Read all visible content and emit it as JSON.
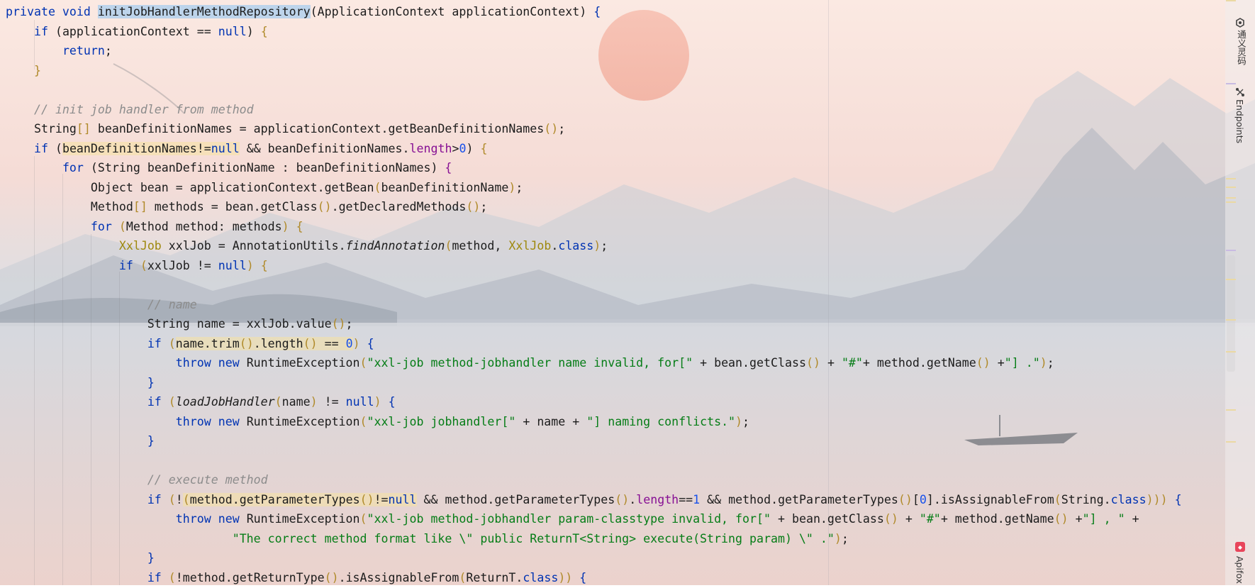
{
  "editor": {
    "lines": [
      [
        [
          "kw",
          "private void "
        ],
        [
          "hl-sel",
          "initJobHandlerMethodRepository"
        ],
        [
          "",
          "("
        ],
        [
          "",
          "ApplicationContext applicationContext"
        ],
        [
          "",
          ") "
        ],
        [
          "kw",
          "{"
        ]
      ],
      [
        [
          "",
          "    "
        ],
        [
          "kw",
          "if "
        ],
        [
          "",
          "(applicationContext == "
        ],
        [
          "kw",
          "null"
        ],
        [
          "",
          ") "
        ],
        [
          "pb",
          "{"
        ]
      ],
      [
        [
          "",
          "        "
        ],
        [
          "kw",
          "return"
        ],
        [
          "",
          ";"
        ]
      ],
      [
        [
          "",
          "    "
        ],
        [
          "pb",
          "}"
        ]
      ],
      [],
      [
        [
          "",
          "    "
        ],
        [
          "cm",
          "// init job handler from method"
        ]
      ],
      [
        [
          "",
          "    String"
        ],
        [
          "pb",
          "[]"
        ],
        [
          "",
          " beanDefinitionNames = applicationContext.getBeanDefinitionNames"
        ],
        [
          "pb",
          "()"
        ],
        [
          "",
          ";"
        ]
      ],
      [
        [
          "",
          "    "
        ],
        [
          "kw",
          "if "
        ],
        [
          "",
          "("
        ],
        [
          "hl-y",
          "beanDefinitionNames!="
        ],
        [
          "hl-y kw",
          "null"
        ],
        [
          "",
          " && beanDefinitionNames."
        ],
        [
          "fld",
          "length"
        ],
        [
          "",
          ">"
        ],
        [
          "num",
          "0"
        ],
        [
          "",
          ") "
        ],
        [
          "pb",
          "{"
        ]
      ],
      [
        [
          "",
          "        "
        ],
        [
          "kw",
          "for "
        ],
        [
          "",
          "(String beanDefinitionName : beanDefinitionNames) "
        ],
        [
          "fld",
          "{"
        ]
      ],
      [
        [
          "",
          "            Object bean = applicationContext.getBean"
        ],
        [
          "pb",
          "("
        ],
        [
          "",
          "beanDefinitionName"
        ],
        [
          "pb",
          ")"
        ],
        [
          "",
          ";"
        ]
      ],
      [
        [
          "",
          "            Method"
        ],
        [
          "pb",
          "[]"
        ],
        [
          "",
          " methods = bean.getClass"
        ],
        [
          "pb",
          "()"
        ],
        [
          "",
          ".getDeclaredMethods"
        ],
        [
          "pb",
          "()"
        ],
        [
          "",
          ";"
        ]
      ],
      [
        [
          "",
          "            "
        ],
        [
          "kw",
          "for "
        ],
        [
          "pb",
          "("
        ],
        [
          "",
          "Method method: methods"
        ],
        [
          "pb",
          ") {"
        ]
      ],
      [
        [
          "",
          "                "
        ],
        [
          "ty",
          "XxlJob"
        ],
        [
          "",
          " xxlJob = AnnotationUtils."
        ],
        [
          "it",
          "findAnnotation"
        ],
        [
          "pb",
          "("
        ],
        [
          "",
          "method, "
        ],
        [
          "ty",
          "XxlJob"
        ],
        [
          "",
          "."
        ],
        [
          "kw",
          "class"
        ],
        [
          "pb",
          ")"
        ],
        [
          "",
          ";"
        ]
      ],
      [
        [
          "",
          "                "
        ],
        [
          "kw",
          "if "
        ],
        [
          "pb",
          "("
        ],
        [
          "",
          "xxlJob != "
        ],
        [
          "kw",
          "null"
        ],
        [
          "pb",
          ") {"
        ]
      ],
      [],
      [
        [
          "",
          "                    "
        ],
        [
          "cm",
          "// name"
        ]
      ],
      [
        [
          "",
          "                    String name = xxlJob.value"
        ],
        [
          "pb",
          "()"
        ],
        [
          "",
          ";"
        ]
      ],
      [
        [
          "",
          "                    "
        ],
        [
          "kw",
          "if "
        ],
        [
          "pb",
          "("
        ],
        [
          "hl-y",
          "name.trim"
        ],
        [
          "hl-y pb",
          "()"
        ],
        [
          "hl-y",
          ".length"
        ],
        [
          "hl-y pb",
          "()"
        ],
        [
          "hl-y",
          " == "
        ],
        [
          "hl-y num",
          "0"
        ],
        [
          "pb",
          ")"
        ],
        [
          "kw",
          " {"
        ]
      ],
      [
        [
          "",
          "                        "
        ],
        [
          "kw",
          "throw new "
        ],
        [
          "",
          "RuntimeException"
        ],
        [
          "pb",
          "("
        ],
        [
          "str",
          "\"xxl-job method-jobhandler name invalid, for[\""
        ],
        [
          "",
          " + bean.getClass"
        ],
        [
          "pb",
          "()"
        ],
        [
          "",
          " + "
        ],
        [
          "str",
          "\"#\""
        ],
        [
          "",
          "+ method.getName"
        ],
        [
          "pb",
          "()"
        ],
        [
          "",
          " +"
        ],
        [
          "str",
          "\"] .\""
        ],
        [
          "pb",
          ")"
        ],
        [
          "",
          ";"
        ]
      ],
      [
        [
          "",
          "                    "
        ],
        [
          "kw",
          "}"
        ]
      ],
      [
        [
          "",
          "                    "
        ],
        [
          "kw",
          "if "
        ],
        [
          "pb",
          "("
        ],
        [
          "it",
          "loadJobHandler"
        ],
        [
          "pb",
          "("
        ],
        [
          "",
          "name"
        ],
        [
          "pb",
          ")"
        ],
        [
          "",
          " != "
        ],
        [
          "kw",
          "null"
        ],
        [
          "pb",
          ")"
        ],
        [
          "kw",
          " {"
        ]
      ],
      [
        [
          "",
          "                        "
        ],
        [
          "kw",
          "throw new "
        ],
        [
          "",
          "RuntimeException"
        ],
        [
          "pb",
          "("
        ],
        [
          "str",
          "\"xxl-job jobhandler[\""
        ],
        [
          "",
          " + name + "
        ],
        [
          "str",
          "\"] naming conflicts.\""
        ],
        [
          "pb",
          ")"
        ],
        [
          "",
          ";"
        ]
      ],
      [
        [
          "",
          "                    "
        ],
        [
          "kw",
          "}"
        ]
      ],
      [],
      [
        [
          "",
          "                    "
        ],
        [
          "cm",
          "// execute method"
        ]
      ],
      [
        [
          "",
          "                    "
        ],
        [
          "kw",
          "if "
        ],
        [
          "pb",
          "("
        ],
        [
          "",
          "!"
        ],
        [
          "hl-y pb",
          "("
        ],
        [
          "hl-y",
          "method.getParameterTypes"
        ],
        [
          "hl-y pb",
          "()"
        ],
        [
          "hl-y",
          "!="
        ],
        [
          "hl-y kw",
          "null"
        ],
        [
          "",
          " && method.getParameterTypes"
        ],
        [
          "pb",
          "()"
        ],
        [
          "",
          "."
        ],
        [
          "fld",
          "length"
        ],
        [
          "",
          "=="
        ],
        [
          "num",
          "1"
        ],
        [
          "",
          " && method.getParameterTypes"
        ],
        [
          "pb",
          "()"
        ],
        [
          "",
          "["
        ],
        [
          "num",
          "0"
        ],
        [
          "",
          "].isAssignableFrom"
        ],
        [
          "pb",
          "("
        ],
        [
          "",
          "String."
        ],
        [
          "kw",
          "class"
        ],
        [
          "pb",
          "))) "
        ],
        [
          "kw",
          "{"
        ]
      ],
      [
        [
          "",
          "                        "
        ],
        [
          "kw",
          "throw new "
        ],
        [
          "",
          "RuntimeException"
        ],
        [
          "pb",
          "("
        ],
        [
          "str",
          "\"xxl-job method-jobhandler param-classtype invalid, for[\""
        ],
        [
          "",
          " + bean.getClass"
        ],
        [
          "pb",
          "()"
        ],
        [
          "",
          " + "
        ],
        [
          "str",
          "\"#\""
        ],
        [
          "",
          "+ method.getName"
        ],
        [
          "pb",
          "()"
        ],
        [
          "",
          " +"
        ],
        [
          "str",
          "\"] , \""
        ],
        [
          "",
          " +"
        ]
      ],
      [
        [
          "",
          "                                "
        ],
        [
          "str",
          "\"The correct method format like \\\" public ReturnT<String> execute(String param) \\\" .\""
        ],
        [
          "pb",
          ")"
        ],
        [
          "",
          ";"
        ]
      ],
      [
        [
          "",
          "                    "
        ],
        [
          "kw",
          "}"
        ]
      ],
      [
        [
          "",
          "                    "
        ],
        [
          "kw",
          "if "
        ],
        [
          "pb",
          "("
        ],
        [
          "",
          "!method.getReturnType"
        ],
        [
          "pb",
          "()"
        ],
        [
          "",
          ".isAssignableFrom"
        ],
        [
          "pb",
          "("
        ],
        [
          "",
          "ReturnT."
        ],
        [
          "kw",
          "class"
        ],
        [
          "pb",
          "))"
        ],
        [
          "",
          " "
        ],
        [
          "kw",
          "{"
        ]
      ]
    ]
  },
  "tool_window": {
    "tongyi_label": "通义灵码",
    "endpoints_label": "Endpoints",
    "apifox_label": "Apifox"
  },
  "colors": {
    "keyword": "#0033b3",
    "string": "#067d17",
    "comment": "#8c8c8c",
    "number": "#1750eb",
    "annotation": "#9e880d",
    "selection": "#a8ceee"
  }
}
